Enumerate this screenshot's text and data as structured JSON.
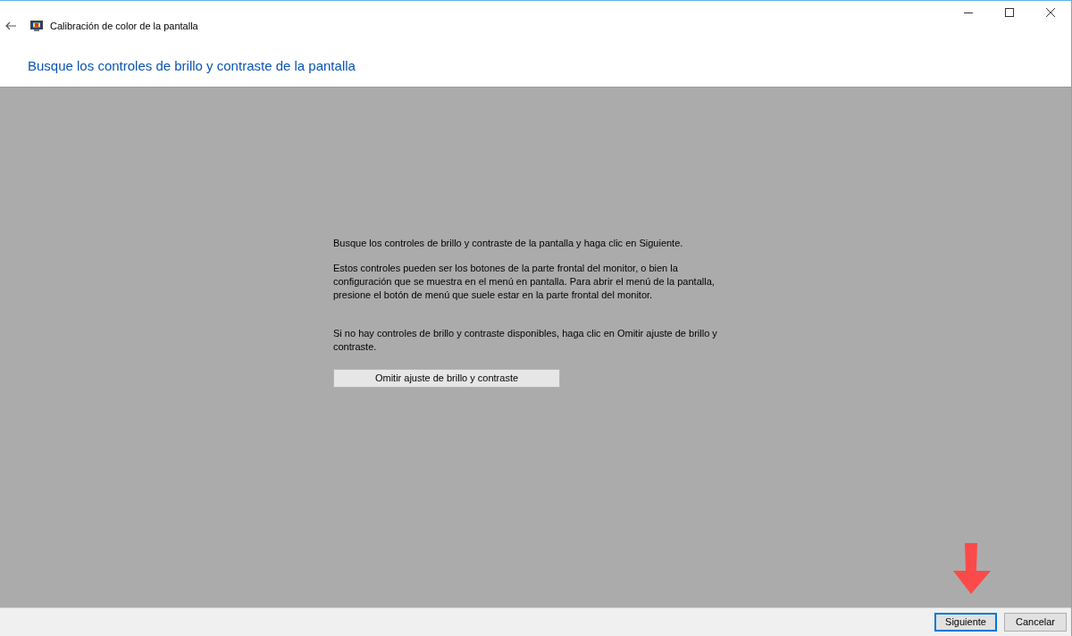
{
  "window": {
    "title": "Calibración de color de la pantalla"
  },
  "heading": "Busque los controles de brillo y contraste de la pantalla",
  "paragraphs": [
    "Busque los controles de brillo y contraste de la pantalla y haga clic en Siguiente.",
    "Estos controles pueden ser los botones de la parte frontal del monitor, o bien la configuración que se muestra en el menú en pantalla. Para abrir el menú de la pantalla, presione el botón de menú que suele estar en la parte frontal del monitor.",
    "Si no hay controles de brillo y contraste disponibles, haga clic en Omitir ajuste de brillo y contraste."
  ],
  "skip_button": "Omitir ajuste de brillo y contraste",
  "buttons": [
    {
      "label": "Siguiente",
      "focused": true
    },
    {
      "label": "Cancelar",
      "focused": false
    }
  ]
}
